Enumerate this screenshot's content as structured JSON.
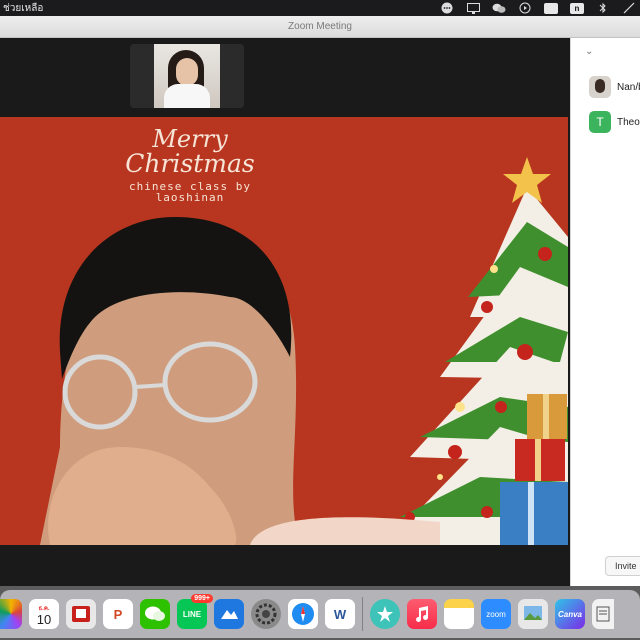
{
  "menubar": {
    "help_menu": "ช่วยเหลือ",
    "tray_n_label": "n",
    "tray_line_label": "LINE"
  },
  "window": {
    "title": "Zoom Meeting"
  },
  "video": {
    "greeting_line1": "Merry",
    "greeting_line2": "Christmas",
    "greeting_line3": "chinese class by laoshinan"
  },
  "participants": {
    "items": [
      {
        "name": "Nan/b",
        "avatar": "photo"
      },
      {
        "name": "Theo",
        "avatar": "letter",
        "initial": "T",
        "color": "#3cb45e"
      }
    ],
    "invite_label": "Invite"
  },
  "dock": {
    "calendar_month": "ธ.ค.",
    "calendar_day": "10",
    "line_label": "LINE",
    "line_badge": "999+",
    "zoom_label": "zoom",
    "canva_label": "Canva",
    "word_label": "W",
    "powerpoint_label": "P"
  },
  "colors": {
    "menubar_bg": "#1b1b1d",
    "video_bg": "#b8361f",
    "tree_green": "#3f8f2e",
    "star_gold": "#f2c24b"
  }
}
